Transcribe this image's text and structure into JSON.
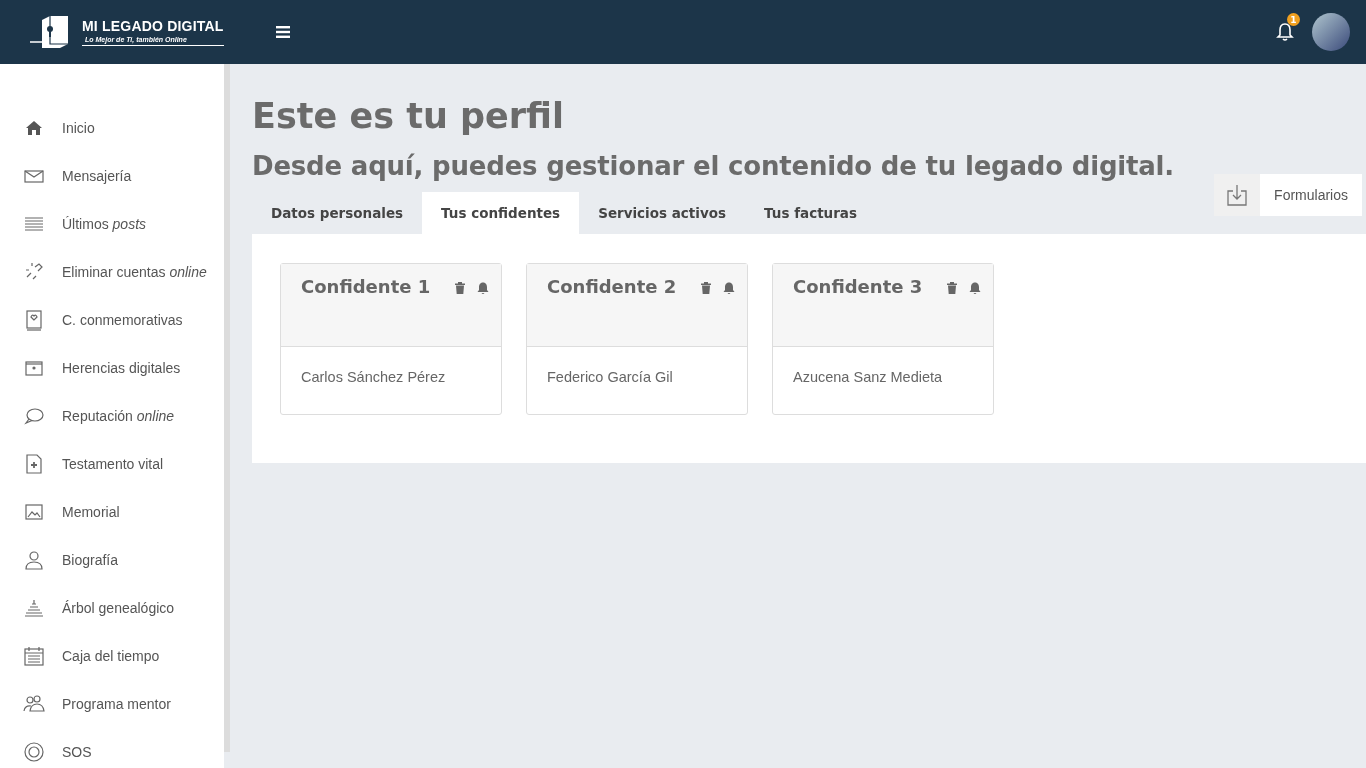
{
  "header": {
    "logo_title": "MI LEGADO DIGITAL",
    "logo_tagline": "Lo Mejor de Ti, también Online",
    "notification_count": "1"
  },
  "sidebar": {
    "items": [
      {
        "label": "Inicio"
      },
      {
        "label": "Mensajería"
      },
      {
        "label": "Últimos *posts*"
      },
      {
        "label": "Eliminar cuentas *online*"
      },
      {
        "label": "C. conmemorativas"
      },
      {
        "label": "Herencias digitales"
      },
      {
        "label": "Reputación *online*"
      },
      {
        "label": "Testamento vital"
      },
      {
        "label": "Memorial"
      },
      {
        "label": "Biografía"
      },
      {
        "label": "Árbol genealógico"
      },
      {
        "label": "Caja del tiempo"
      },
      {
        "label": "Programa mentor"
      },
      {
        "label": "SOS"
      }
    ]
  },
  "page": {
    "title": "Este es tu perfil",
    "subtitle": "Desde aquí, puedes gestionar el contenido de tu legado digital."
  },
  "tabs": [
    {
      "label": "Datos personales",
      "selected": false
    },
    {
      "label": "Tus confidentes",
      "selected": true
    },
    {
      "label": "Servicios activos",
      "selected": false
    },
    {
      "label": "Tus facturas",
      "selected": false
    }
  ],
  "forms_button": {
    "label": "Formularios"
  },
  "confidants": [
    {
      "title": "Confidente 1",
      "name": "Carlos Sánchez Pérez"
    },
    {
      "title": "Confidente 2",
      "name": "Federico García Gil"
    },
    {
      "title": "Confidente 3",
      "name": "Azucena Sanz Medieta"
    }
  ]
}
